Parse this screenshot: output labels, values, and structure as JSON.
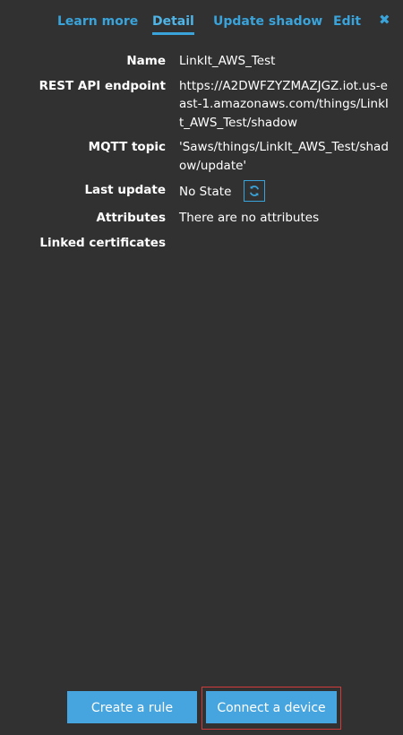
{
  "tabs": [
    {
      "label": "Learn more",
      "active": false
    },
    {
      "label": "Detail",
      "active": true
    },
    {
      "label": "Update shadow",
      "active": false
    },
    {
      "label": "Edit",
      "active": false
    }
  ],
  "close_icon": "close-icon",
  "details": {
    "name_label": "Name",
    "name_value": "LinkIt_AWS_Test",
    "endpoint_label": "REST API endpoint",
    "endpoint_value": "https://A2DWFZYZMAZJGZ.iot.us-east-1.amazonaws.com/things/LinkIt_AWS_Test/shadow",
    "mqtt_label": "MQTT topic",
    "mqtt_value": "'Saws/things/LinkIt_AWS_Test/shadow/update'",
    "last_update_label": "Last update",
    "last_update_value": "No State",
    "attributes_label": "Attributes",
    "attributes_value": "There are no attributes",
    "certificates_label": "Linked certificates"
  },
  "refresh_icon": "refresh-icon",
  "buttons": {
    "create_rule": "Create a rule",
    "connect_device": "Connect a device"
  },
  "colors": {
    "background": "#313131",
    "accent": "#39a3da",
    "button": "#46a5de",
    "highlight": "#d23b3b"
  }
}
